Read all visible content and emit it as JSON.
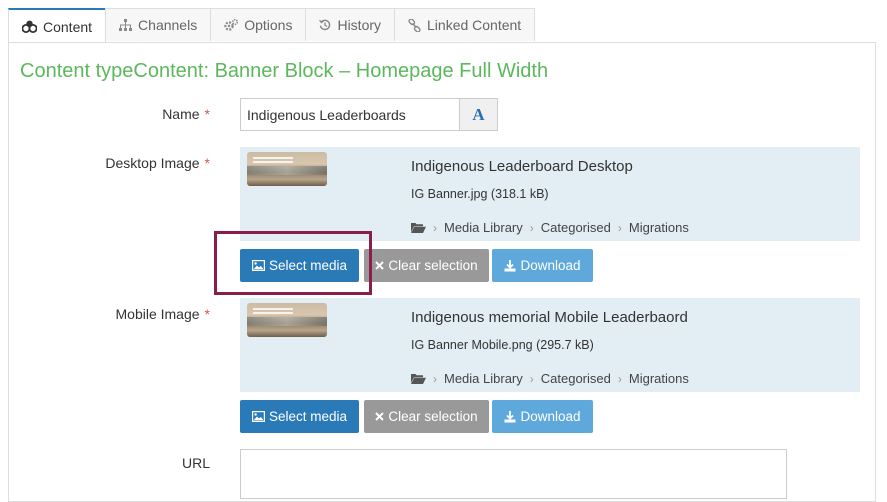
{
  "tabs": [
    {
      "label": "Content",
      "icon": "cubes-icon",
      "active": true
    },
    {
      "label": "Channels",
      "icon": "sitemap-icon",
      "active": false
    },
    {
      "label": "Options",
      "icon": "cogs-icon",
      "active": false
    },
    {
      "label": "History",
      "icon": "history-icon",
      "active": false
    },
    {
      "label": "Linked Content",
      "icon": "link-icon",
      "active": false
    }
  ],
  "page_title": "Content typeContent: Banner Block – Homepage Full Width",
  "fields": {
    "name": {
      "label": "Name",
      "required_mark": "*",
      "value": "Indigenous Leaderboards",
      "translate_label": "A"
    },
    "desktop_image": {
      "label": "Desktop Image",
      "required_mark": "*",
      "media_name": "Indigenous Leaderboard Desktop",
      "file": "IG Banner.jpg (318.1 kB)",
      "path": [
        "Media Library",
        "Categorised",
        "Migrations"
      ]
    },
    "mobile_image": {
      "label": "Mobile Image",
      "required_mark": "*",
      "media_name": "Indigenous memorial Mobile Leaderbaord",
      "file": "IG Banner Mobile.png (295.7 kB)",
      "path": [
        "Media Library",
        "Categorised",
        "Migrations"
      ]
    },
    "url": {
      "label": "URL",
      "value": ""
    }
  },
  "buttons": {
    "select_media": "Select media",
    "clear_selection": "Clear selection",
    "download": "Download"
  },
  "colors": {
    "accent": "#2a7ab8",
    "title_green": "#5cb85c",
    "required_red": "#d9534f",
    "highlight": "#8a1e4a",
    "card_bg": "#e3eef4"
  }
}
